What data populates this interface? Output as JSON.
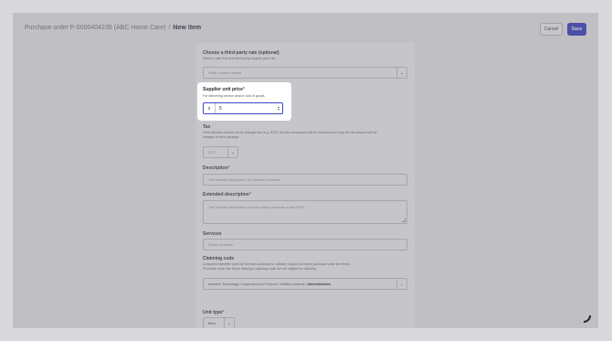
{
  "header": {
    "breadcrumb_parent": "Purchase order P-0000404235 (ABC Home Care)",
    "breadcrumb_separator": "/",
    "breadcrumb_current": "New item",
    "cancel_label": "Cancel",
    "save_label": "Save"
  },
  "form": {
    "third_party": {
      "label": "Choose a third-party rate (optional)",
      "help": "Select a rate from the third-party supplier price list",
      "placeholder": "Enter custom values"
    },
    "supplier_price": {
      "label": "Supplier unit price",
      "required": "*",
      "help": "For delivering service and/or cost of goods",
      "prefix": "$",
      "value": "5"
    },
    "tax": {
      "label": "Tax",
      "help": "If the Member should not be charged tax (e.g. HCP), the tax component will be removed and only the net amount will be charged to their package.",
      "value": "GST"
    },
    "description": {
      "label": "Description",
      "required": "*",
      "placeholder": "The friendly description for Member invoices"
    },
    "extended_description": {
      "label": "Extended description",
      "required": "*",
      "placeholder": "The precise description for third-party purchase order PDFs"
    },
    "services": {
      "label": "Services",
      "placeholder": "Select services"
    },
    "claiming_code": {
      "label": "Claiming code",
      "help_1": "A required identifier used by Services Australia to validate Support at Home purchase order line items.",
      "help_2": "Purchase order line items missing a claiming code are not eligible for claiming.",
      "value_path": "Assistive Technology / Equipment and Products / Mobility products / ",
      "value_leaf": "Administration"
    },
    "unit_type": {
      "label": "Unit type",
      "required": "*",
      "value": "Item"
    }
  }
}
